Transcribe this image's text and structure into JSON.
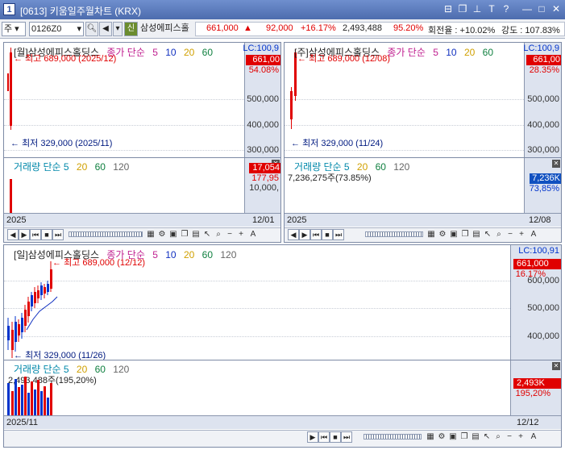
{
  "window": {
    "app_icon": "1",
    "title": "[0613] 키움일주월차트 (KRX)",
    "controls": [
      "⊟",
      "❐",
      "📌",
      "T",
      "?",
      "—",
      "□",
      "✕"
    ]
  },
  "toolbar": {
    "mode": "주",
    "code": "0126Z0",
    "new_badge": "신",
    "name": "삼성에피스홀",
    "price": "661,000",
    "change": "92,000",
    "change_pct": "+16.17%",
    "volume": "2,493,488",
    "vol_ratio": "95.20%",
    "turnover": "회전율 : +10.02%",
    "strength": "강도 : 107.83%",
    "up_mark": "▲"
  },
  "monthly": {
    "legend_title": "[월]삼성에피스홀딩스",
    "legend_ma": "종가 단순",
    "ma_periods": [
      "5",
      "10",
      "20",
      "60"
    ],
    "high_note": "최고 689,000 (2025/12)",
    "low_note": "최저 329,000 (2025/11)",
    "lc": "LC:100,9",
    "price_badge": "661,00",
    "pct": "54.08%",
    "y_ticks": [
      "500,000",
      "400,000",
      "300,000"
    ],
    "vol_legend": "거래량 단순 5",
    "vol_periods": [
      "20",
      "60",
      "120"
    ],
    "vol_badge": "17,054",
    "vol_sub": "177,95",
    "vol_tick": "10,000,",
    "date_left": "2025",
    "date_right": "12/01"
  },
  "weekly": {
    "legend_title": "[주]삼성에피스홀딩스",
    "legend_ma": "종가 단순",
    "ma_periods": [
      "5",
      "10",
      "20",
      "60"
    ],
    "high_note": "최고 689,000 (12/08)",
    "low_note": "최저 329,000 (11/24)",
    "lc": "LC:100,9",
    "price_badge": "661,00",
    "pct": "28.35%",
    "y_ticks": [
      "500,000",
      "400,000",
      "300,000"
    ],
    "vol_legend": "거래량 단순 5",
    "vol_periods": [
      "20",
      "60",
      "120"
    ],
    "vol_value": "7,236,275주(73.85%)",
    "vol_badge": "7,236K",
    "vol_sub": "73,85%",
    "date_left": "2025",
    "date_right": "12/08"
  },
  "daily": {
    "legend_title": "[일]삼성에피스홀딩스",
    "legend_ma": "종가 단순",
    "ma_periods": [
      "5",
      "10",
      "20",
      "60",
      "120"
    ],
    "high_note": "최고 689,000 (12/12)",
    "low_note": "최저 329,000 (11/26)",
    "lc": "LC:100,91",
    "price_badge": "661,000",
    "pct": "16.17%",
    "y_ticks": [
      "600,000",
      "500,000",
      "400,000"
    ],
    "vol_legend": "거래량 단순 5",
    "vol_periods": [
      "20",
      "60",
      "120"
    ],
    "vol_value": "2,493,488주(195,20%)",
    "vol_badge": "2,493K",
    "vol_sub": "195,20%",
    "date_left": "2025/11",
    "date_right": "12/12"
  },
  "colors": {
    "up": "#e00000",
    "down": "#0033cc",
    "ma5": "#c02090",
    "ma10": "#1030c0",
    "ma20": "#d0a000",
    "ma60": "#108040",
    "ma120": "#666666"
  },
  "icons": {
    "ctrl_left": "◀",
    "ctrl_right": "▶",
    "ctrl_first": "⏮",
    "ctrl_stop": "■",
    "ctrl_last": "⏭",
    "zoom_out": "−",
    "zoom_in": "+",
    "text_tool": "A",
    "arrow_left": "←",
    "arrow_sym": "◀"
  }
}
